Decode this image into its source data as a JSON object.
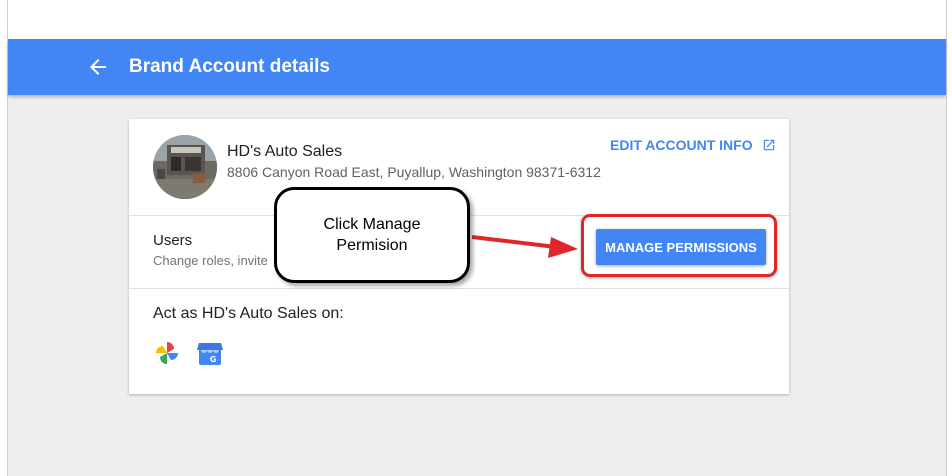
{
  "appbar": {
    "title": "Brand Account details",
    "back_icon": "arrow-back-icon",
    "color": "#4285f4"
  },
  "account": {
    "name": "HD's Auto Sales",
    "address": "8806 Canyon Road East, Puyallup, Washington 98371-6312",
    "edit_label": "EDIT ACCOUNT INFO",
    "edit_icon": "open-in-new-icon"
  },
  "users": {
    "label": "Users",
    "sublabel": "Change roles, invite",
    "manage_button": "MANAGE PERMISSIONS"
  },
  "act_as": {
    "label": "Act as HD's Auto Sales on:",
    "services": [
      "google-photos-icon",
      "google-my-business-icon"
    ]
  },
  "annotation": {
    "callout_text": "Click Manage Permision",
    "highlight_color": "#e0262a"
  }
}
